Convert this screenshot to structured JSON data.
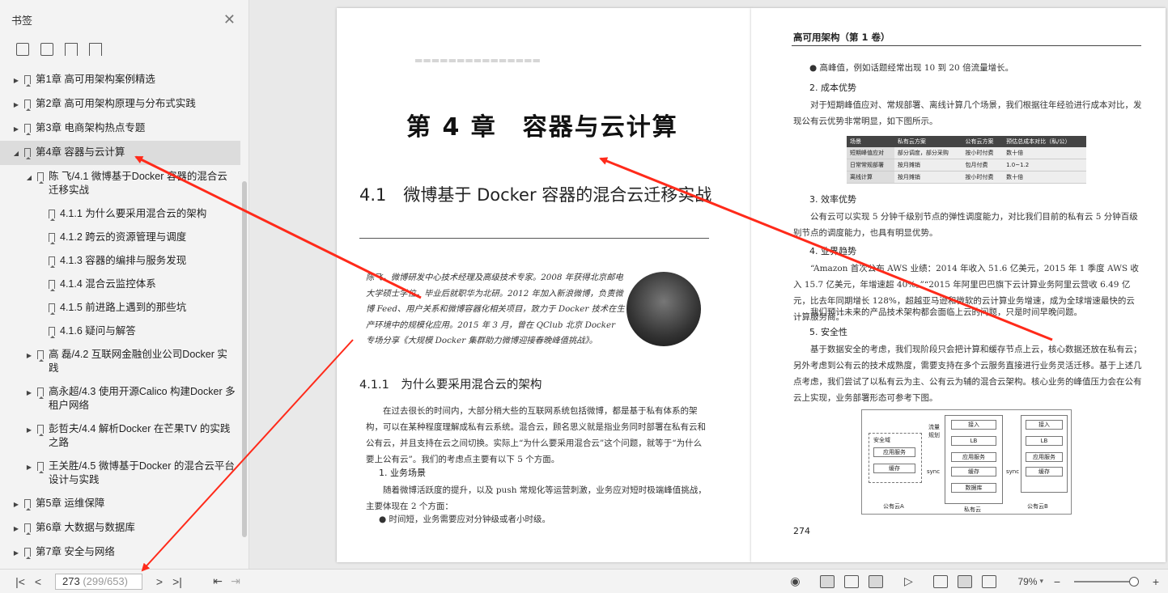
{
  "sidebar": {
    "title": "书签",
    "close_icon": "close-icon",
    "tools": [
      "add-bookmark-icon",
      "delete-bookmark-icon",
      "bookmark-icon",
      "bookmark-outline-icon"
    ],
    "items": [
      {
        "label": "第1章 高可用架构案例精选",
        "level": 0,
        "caret": "▶"
      },
      {
        "label": "第2章 高可用架构原理与分布式实践",
        "level": 0,
        "caret": "▶"
      },
      {
        "label": "第3章 电商架构热点专题",
        "level": 0,
        "caret": "▶"
      },
      {
        "label": "第4章 容器与云计算",
        "level": 0,
        "caret": "◢",
        "active": true
      },
      {
        "label": "陈 飞/4.1 微博基于Docker 容器的混合云迁移实战",
        "level": 1,
        "caret": "◢"
      },
      {
        "label": "4.1.1 为什么要采用混合云的架构",
        "level": 2,
        "caret": ""
      },
      {
        "label": "4.1.2 跨云的资源管理与调度",
        "level": 2,
        "caret": ""
      },
      {
        "label": "4.1.3 容器的编排与服务发现",
        "level": 2,
        "caret": ""
      },
      {
        "label": "4.1.4 混合云监控体系",
        "level": 2,
        "caret": ""
      },
      {
        "label": "4.1.5 前进路上遇到的那些坑",
        "level": 2,
        "caret": ""
      },
      {
        "label": "4.1.6 疑问与解答",
        "level": 2,
        "caret": ""
      },
      {
        "label": "高 磊/4.2 互联网金融创业公司Docker 实践",
        "level": 1,
        "caret": "▶"
      },
      {
        "label": "高永超/4.3 使用开源Calico 构建Docker 多租户网络",
        "level": 1,
        "caret": "▶"
      },
      {
        "label": "彭哲夫/4.4 解析Docker 在芒果TV 的实践之路",
        "level": 1,
        "caret": "▶"
      },
      {
        "label": "王关胜/4.5 微博基于Docker 的混合云平台设计与实践",
        "level": 1,
        "caret": "▶"
      },
      {
        "label": "第5章 运维保障",
        "level": 0,
        "caret": "▶"
      },
      {
        "label": "第6章 大数据与数据库",
        "level": 0,
        "caret": "▶"
      },
      {
        "label": "第7章 安全与网络",
        "level": 0,
        "caret": "▶"
      }
    ]
  },
  "bottom": {
    "page_current": "273",
    "page_info": "(299/653)",
    "zoom": "79%"
  },
  "left_page": {
    "chapter_title": "第 4 章　容器与云计算",
    "section_title": "4.1　微博基于 Docker 容器的混合云迁移实战",
    "author_bio": "陈飞，微博研发中心技术经理及高级技术专家。2008 年获得北京邮电大学硕士学位，毕业后就职华为北研。2012 年加入新浪微博，负责微博 Feed、用户关系和微博容器化相关项目，致力于 Docker 技术在生产环境中的规模化应用。2015 年 3 月，曾在 QClub 北京 Docker 专场分享《大规模 Docker 集群助力微博迎接春晚峰值挑战》。",
    "subsection": "4.1.1　为什么要采用混合云的架构",
    "para1": "在过去很长的时间内，大部分稍大些的互联网系统包括微博，都是基于私有体系的架构，可以在某种程度理解成私有云系统。混合云，顾名思义就是指业务同时部署在私有云和公有云，并且支持在云之间切换。实际上“为什么要采用混合云”这个问题，就等于“为什么要上公有云”。我们的考虑点主要有以下 5 个方面。",
    "h1": "1. 业务场景",
    "para2": "随着微博活跃度的提升，以及 push 常规化等运营刺激，业务应对短时极端峰值挑战，主要体现在 2 个方面：",
    "bullet1": "● 时间短，业务需要应对分钟级或者小时级。"
  },
  "right_page": {
    "running_head": "高可用架构（第 1 卷）",
    "bullet": "● 高峰值，例如话题经常出现 10 到 20 倍流量增长。",
    "h2": "2. 成本优势",
    "p2": "对于短期峰值应对、常规部署、离线计算几个场景，我们根据往年经验进行成本对比，发现公有云优势非常明显，如下图所示。",
    "table_headers": [
      "场景",
      "私有云方案",
      "公有云方案",
      "预估总成本对比（私/公）"
    ],
    "table_rows": [
      [
        "短期峰值应对",
        "部分调度，部分采购",
        "按小时付费",
        "数十倍"
      ],
      [
        "日常常规部署",
        "按月摊销",
        "包月付费",
        "1.0~1.2"
      ],
      [
        "离线计算",
        "按月摊销",
        "按小时付费",
        "数十倍"
      ]
    ],
    "h3": "3. 效率优势",
    "p3": "公有云可以实现 5 分钟千级别节点的弹性调度能力，对比我们目前的私有云 5 分钟百级别节点的调度能力，也具有明显优势。",
    "h4": "4. 业界趋势",
    "p4": "“Amazon 首次公布 AWS 业绩：2014 年收入 51.6 亿美元，2015 年 1 季度 AWS 收入 15.7 亿美元，年增速超 40%。”“2015 年阿里巴巴旗下云计算业务阿里云营收 6.49 亿元，比去年同期增长 128%，超越亚马逊和微软的云计算业务增速，成为全球增速最快的云计算服务商。”",
    "p4b": "我们预计未来的产品技术架构都会面临上云的问题，只是时间早晚问题。",
    "h5": "5. 安全性",
    "p5": "基于数据安全的考虑，我们现阶段只会把计算和缓存节点上云，核心数据还放在私有云；另外考虑到公有云的技术成熟度，需要支持在多个云服务直接进行业务灵活迁移。基于上述几点考虑，我们尝试了以私有云为主、公有云为辅的混合云架构。核心业务的峰值压力会在公有云上实现，业务部署形态可参考下图。",
    "diagram": {
      "secure_domain": "安全域",
      "app_service": "应用服务",
      "cache": "缓存",
      "access": "接入",
      "lb": "LB",
      "database": "数据库",
      "flow_plan": "流量规划",
      "sync": "sync",
      "public_a": "公有云A",
      "private": "私有云",
      "public_b": "公有云B"
    },
    "page_number": "274"
  },
  "annotation": {
    "arrow_color": "#ff2a1a"
  }
}
